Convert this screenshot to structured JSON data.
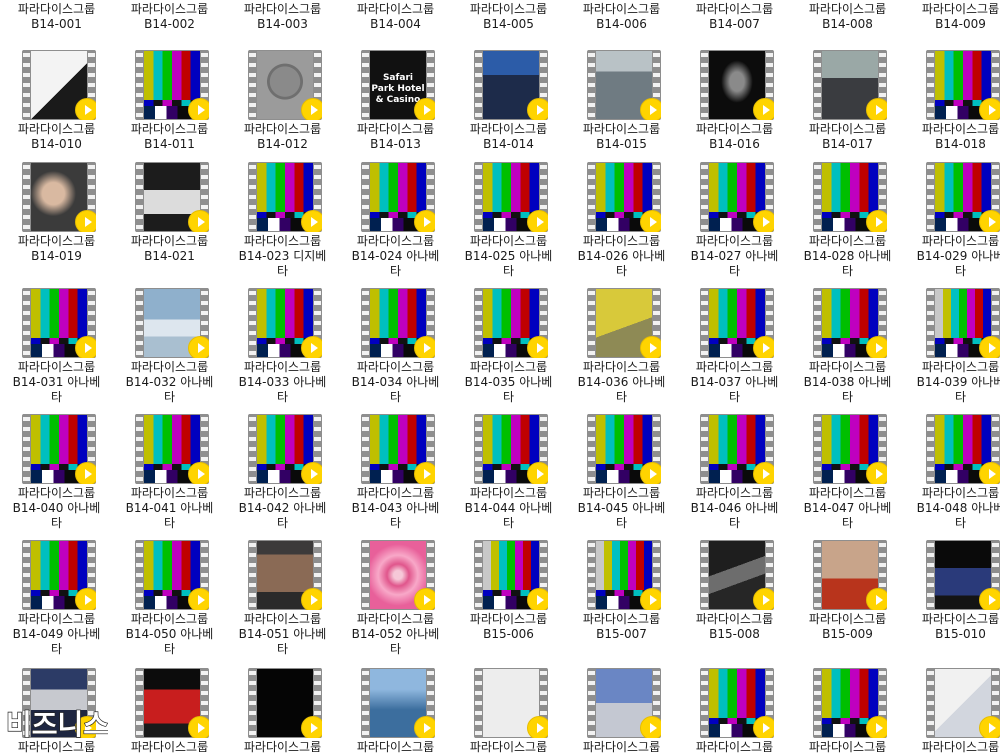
{
  "watermark": {
    "text": "비즈니스"
  },
  "tiles": [
    [
      {
        "line1": "파라다이스그룹",
        "line2": "B14-001",
        "line3": "",
        "icon": "video-file-icon",
        "kind": "scene",
        "bg": "#3a3a3a"
      },
      {
        "line1": "파라다이스그룹",
        "line2": "B14-002",
        "line3": "",
        "icon": "video-file-icon",
        "kind": "scene",
        "bg": "#2c2c34"
      },
      {
        "line1": "파라다이스그룹",
        "line2": "B14-003",
        "line3": "",
        "icon": "video-file-icon",
        "kind": "scene",
        "bg": "#3d3d3d"
      },
      {
        "line1": "파라다이스그룹",
        "line2": "B14-004",
        "line3": "",
        "icon": "video-file-icon",
        "kind": "scene",
        "bg": "#2b2b2b"
      },
      {
        "line1": "파라다이스그룹",
        "line2": "B14-005",
        "line3": "",
        "icon": "video-file-icon",
        "kind": "scene",
        "bg": "#454545"
      },
      {
        "line1": "파라다이스그룹",
        "line2": "B14-006",
        "line3": "",
        "icon": "video-file-icon",
        "kind": "scene",
        "bg": "#525252"
      },
      {
        "line1": "파라다이스그룹",
        "line2": "B14-007",
        "line3": "",
        "icon": "video-file-icon",
        "kind": "scene",
        "bg": "#333333"
      },
      {
        "line1": "파라다이스그룹",
        "line2": "B14-008",
        "line3": "",
        "icon": "video-file-icon",
        "kind": "scene",
        "bg": "#3b3b3b"
      },
      {
        "line1": "파라다이스그룹",
        "line2": "B14-009",
        "line3": "",
        "icon": "video-file-icon",
        "kind": "scene",
        "bg": "#444444"
      }
    ],
    [
      {
        "line1": "파라다이스그룹",
        "line2": "B14-010",
        "line3": "",
        "icon": "video-file-icon",
        "kind": "scene",
        "bg": "linear-gradient(135deg,#f3f3f3 0 55%,#1a1a1a 55%)"
      },
      {
        "line1": "파라다이스그룹",
        "line2": "B14-011",
        "line3": "",
        "icon": "video-file-icon",
        "kind": "bars"
      },
      {
        "line1": "파라다이스그룹",
        "line2": "B14-012",
        "line3": "",
        "icon": "video-file-icon",
        "kind": "scene",
        "bg": "radial-gradient(circle at 50% 45%,#8a8a8a 0 32%,#6f6f6f 33% 38%,#9b9b9b 39%)"
      },
      {
        "line1": "파라다이스그룹",
        "line2": "B14-013",
        "line3": "",
        "icon": "video-file-icon",
        "kind": "scene",
        "bg": "#111111",
        "text": "Safari Park Hotel\n& Casino"
      },
      {
        "line1": "파라다이스그룹",
        "line2": "B14-014",
        "line3": "",
        "icon": "video-file-icon",
        "kind": "scene",
        "bg": "linear-gradient(to bottom,#2c5ca8 0 35%,#1d2b4a 35%)"
      },
      {
        "line1": "파라다이스그룹",
        "line2": "B14-015",
        "line3": "",
        "icon": "video-file-icon",
        "kind": "scene",
        "bg": "linear-gradient(to bottom,#b9c2c6 0 30%,#6f7b82 30%)"
      },
      {
        "line1": "파라다이스그룹",
        "line2": "B14-016",
        "line3": "",
        "icon": "video-file-icon",
        "kind": "scene",
        "bg": "radial-gradient(ellipse at 50% 45%,#8a8a8a 0 18%,#0c0c0c 40%)"
      },
      {
        "line1": "파라다이스그룹",
        "line2": "B14-017",
        "line3": "",
        "icon": "video-file-icon",
        "kind": "scene",
        "bg": "linear-gradient(to bottom,#9aa8a6 0 40%,#3a3c40 40%)"
      },
      {
        "line1": "파라다이스그룹",
        "line2": "B14-018",
        "line3": "",
        "icon": "video-file-icon",
        "kind": "bars"
      }
    ],
    [
      {
        "line1": "파라다이스그룹",
        "line2": "B14-019",
        "line3": "",
        "icon": "video-file-icon",
        "kind": "scene",
        "bg": "radial-gradient(circle at 40% 45%,#d9b9a1 0 22%,#3b3b3b 45%)"
      },
      {
        "line1": "파라다이스그룹",
        "line2": "B14-021",
        "line3": "",
        "icon": "video-file-icon",
        "kind": "scene",
        "bg": "linear-gradient(to bottom,#1c1c1c 0 40%,#dcdcdc 40% 75%,#1c1c1c 75%)"
      },
      {
        "line1": "파라다이스그룹",
        "line2": "B14-023 디지베",
        "line3": "타",
        "icon": "video-file-icon",
        "kind": "bars"
      },
      {
        "line1": "파라다이스그룹",
        "line2": "B14-024 아나베",
        "line3": "타",
        "icon": "video-file-icon",
        "kind": "bars"
      },
      {
        "line1": "파라다이스그룹",
        "line2": "B14-025 아나베",
        "line3": "타",
        "icon": "video-file-icon",
        "kind": "bars"
      },
      {
        "line1": "파라다이스그룹",
        "line2": "B14-026 아나베",
        "line3": "타",
        "icon": "video-file-icon",
        "kind": "bars"
      },
      {
        "line1": "파라다이스그룹",
        "line2": "B14-027 아나베",
        "line3": "타",
        "icon": "video-file-icon",
        "kind": "bars"
      },
      {
        "line1": "파라다이스그룹",
        "line2": "B14-028 아나베",
        "line3": "타",
        "icon": "video-file-icon",
        "kind": "bars"
      },
      {
        "line1": "파라다이스그룹",
        "line2": "B14-029 아나베",
        "line3": "타",
        "icon": "video-file-icon",
        "kind": "bars"
      }
    ],
    [
      {
        "line1": "파라다이스그룹",
        "line2": "B14-031 아나베",
        "line3": "타",
        "icon": "video-file-icon",
        "kind": "bars"
      },
      {
        "line1": "파라다이스그룹",
        "line2": "B14-032 아나베",
        "line3": "타",
        "icon": "video-file-icon",
        "kind": "scene",
        "bg": "linear-gradient(to bottom,#8fb0cc 0 45%,#dde6ee 45% 70%,#a9bfd0 70%)"
      },
      {
        "line1": "파라다이스그룹",
        "line2": "B14-033 아나베",
        "line3": "타",
        "icon": "video-file-icon",
        "kind": "bars"
      },
      {
        "line1": "파라다이스그룹",
        "line2": "B14-034 아나베",
        "line3": "타",
        "icon": "video-file-icon",
        "kind": "bars"
      },
      {
        "line1": "파라다이스그룹",
        "line2": "B14-035 아나베",
        "line3": "타",
        "icon": "video-file-icon",
        "kind": "bars"
      },
      {
        "line1": "파라다이스그룹",
        "line2": "B14-036 아나베",
        "line3": "타",
        "icon": "video-file-icon",
        "kind": "scene",
        "bg": "linear-gradient(160deg,#d8c93a 0 55%,#8e8a55 55%)"
      },
      {
        "line1": "파라다이스그룹",
        "line2": "B14-037 아나베",
        "line3": "타",
        "icon": "video-file-icon",
        "kind": "bars"
      },
      {
        "line1": "파라다이스그룹",
        "line2": "B14-038 아나베",
        "line3": "타",
        "icon": "video-file-icon",
        "kind": "bars"
      },
      {
        "line1": "파라다이스그룹",
        "line2": "B14-039 아나베",
        "line3": "타",
        "icon": "video-file-icon",
        "kind": "bars-alt"
      }
    ],
    [
      {
        "line1": "파라다이스그룹",
        "line2": "B14-040 아나베",
        "line3": "타",
        "icon": "video-file-icon",
        "kind": "bars"
      },
      {
        "line1": "파라다이스그룹",
        "line2": "B14-041 아나베",
        "line3": "타",
        "icon": "video-file-icon",
        "kind": "bars"
      },
      {
        "line1": "파라다이스그룹",
        "line2": "B14-042 아나베",
        "line3": "타",
        "icon": "video-file-icon",
        "kind": "bars"
      },
      {
        "line1": "파라다이스그룹",
        "line2": "B14-043 아나베",
        "line3": "타",
        "icon": "video-file-icon",
        "kind": "bars"
      },
      {
        "line1": "파라다이스그룹",
        "line2": "B14-044 아나베",
        "line3": "타",
        "icon": "video-file-icon",
        "kind": "bars"
      },
      {
        "line1": "파라다이스그룹",
        "line2": "B14-045 아나베",
        "line3": "타",
        "icon": "video-file-icon",
        "kind": "bars"
      },
      {
        "line1": "파라다이스그룹",
        "line2": "B14-046 아나베",
        "line3": "타",
        "icon": "video-file-icon",
        "kind": "bars"
      },
      {
        "line1": "파라다이스그룹",
        "line2": "B14-047 아나베",
        "line3": "타",
        "icon": "video-file-icon",
        "kind": "bars"
      },
      {
        "line1": "파라다이스그룹",
        "line2": "B14-048 아나베",
        "line3": "타",
        "icon": "video-file-icon",
        "kind": "bars"
      }
    ],
    [
      {
        "line1": "파라다이스그룹",
        "line2": "B14-049 아나베",
        "line3": "타",
        "icon": "video-file-icon",
        "kind": "bars"
      },
      {
        "line1": "파라다이스그룹",
        "line2": "B14-050 아나베",
        "line3": "타",
        "icon": "video-file-icon",
        "kind": "bars"
      },
      {
        "line1": "파라다이스그룹",
        "line2": "B14-051 아나베",
        "line3": "타",
        "icon": "video-file-icon",
        "kind": "scene",
        "bg": "linear-gradient(to bottom,#3c3a3a 0 20%,#8a6a55 20% 75%,#2a2a2a 75%)"
      },
      {
        "line1": "파라다이스그룹",
        "line2": "B14-052 아나베",
        "line3": "타",
        "icon": "video-file-icon",
        "kind": "scene",
        "bg": "radial-gradient(circle at 50% 50%,#f6c8d8 0 10%,#e0568c 25%,#f8a8c8 45%,#e8609a 70%)"
      },
      {
        "line1": "파라다이스그룹",
        "line2": "B15-006",
        "line3": "",
        "icon": "video-file-icon",
        "kind": "bars-alt"
      },
      {
        "line1": "파라다이스그룹",
        "line2": "B15-007",
        "line3": "",
        "icon": "video-file-icon",
        "kind": "bars-alt"
      },
      {
        "line1": "파라다이스그룹",
        "line2": "B15-008",
        "line3": "",
        "icon": "video-file-icon",
        "kind": "scene",
        "bg": "linear-gradient(160deg,#1e1e1e 0 40%,#6d6d6d 40% 60%,#262626 60%)"
      },
      {
        "line1": "파라다이스그룹",
        "line2": "B15-009",
        "line3": "",
        "icon": "video-file-icon",
        "kind": "scene",
        "bg": "linear-gradient(to bottom,#c8a48a 0 55%,#b8341c 55%)"
      },
      {
        "line1": "파라다이스그룹",
        "line2": "B15-010",
        "line3": "",
        "icon": "video-file-icon",
        "kind": "scene",
        "bg": "linear-gradient(to bottom,#0a0a0a 0 40%,#2a3a7a 40% 80%,#141414 80%)"
      }
    ],
    [
      {
        "line1": "파라다이스그룹",
        "line2": "",
        "line3": "",
        "icon": "video-file-icon",
        "kind": "scene",
        "bg": "linear-gradient(to bottom,#2c3b66 0 30%,#c7c9cf 30% 60%,#1e2640 60%)"
      },
      {
        "line1": "파라다이스그룹",
        "line2": "",
        "line3": "",
        "icon": "video-file-icon",
        "kind": "scene",
        "bg": "linear-gradient(to bottom,#0c0c0c 0 30%,#c81e1e 30% 80%,#1a1a1a 80%)"
      },
      {
        "line1": "파라다이스그룹",
        "line2": "",
        "line3": "",
        "icon": "video-file-icon",
        "kind": "scene",
        "bg": "#050505"
      },
      {
        "line1": "파라다이스그룹",
        "line2": "",
        "line3": "",
        "icon": "video-file-icon",
        "kind": "scene",
        "bg": "linear-gradient(to top,#3c6e9e 0 40%,#8fb7de 70%)"
      },
      {
        "line1": "파라다이스그룹",
        "line2": "",
        "line3": "",
        "icon": "video-file-icon",
        "kind": "scene",
        "bg": "#ededed"
      },
      {
        "line1": "파라다이스그룹",
        "line2": "",
        "line3": "",
        "icon": "video-file-icon",
        "kind": "scene",
        "bg": "linear-gradient(to bottom,#6a86c4 0 50%,#c4c8d2 50%)"
      },
      {
        "line1": "파라다이스그룹",
        "line2": "",
        "line3": "",
        "icon": "video-file-icon",
        "kind": "bars"
      },
      {
        "line1": "파라다이스그룹",
        "line2": "",
        "line3": "",
        "icon": "video-file-icon",
        "kind": "bars"
      },
      {
        "line1": "파라다이스그룹",
        "line2": "",
        "line3": "",
        "icon": "video-file-icon",
        "kind": "scene",
        "bg": "linear-gradient(135deg,#f1f1f1 0 50%,#d2d6de 50%)"
      }
    ]
  ]
}
